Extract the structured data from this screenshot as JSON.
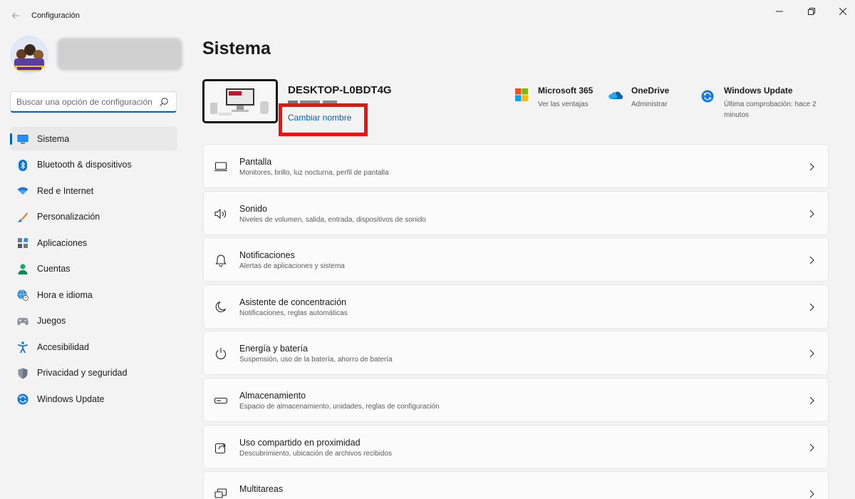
{
  "window": {
    "title": "Configuración"
  },
  "sidebar": {
    "search_placeholder": "Buscar una opción de configuración",
    "items": [
      {
        "label": "Sistema",
        "icon": "monitor-icon",
        "active": true
      },
      {
        "label": "Bluetooth & dispositivos",
        "icon": "bluetooth-icon"
      },
      {
        "label": "Red e Internet",
        "icon": "wifi-icon"
      },
      {
        "label": "Personalización",
        "icon": "brush-icon"
      },
      {
        "label": "Aplicaciones",
        "icon": "apps-icon"
      },
      {
        "label": "Cuentas",
        "icon": "person-icon"
      },
      {
        "label": "Hora e idioma",
        "icon": "globe-clock-icon"
      },
      {
        "label": "Juegos",
        "icon": "gamepad-icon"
      },
      {
        "label": "Accesibilidad",
        "icon": "accessibility-icon"
      },
      {
        "label": "Privacidad y seguridad",
        "icon": "shield-icon"
      },
      {
        "label": "Windows Update",
        "icon": "update-icon"
      }
    ]
  },
  "main": {
    "title": "Sistema",
    "device": {
      "name": "DESKTOP-L0BDT4G",
      "rename_label": "Cambiar nombre"
    },
    "quick_links": [
      {
        "title": "Microsoft 365",
        "subtitle": "Ver las ventajas",
        "icon": "microsoft-logo-icon"
      },
      {
        "title": "OneDrive",
        "subtitle": "Administrar",
        "icon": "onedrive-cloud-icon"
      },
      {
        "title": "Windows Update",
        "subtitle": "Última comprobación: hace 2 minutos",
        "icon": "windows-update-icon"
      }
    ],
    "cards": [
      {
        "title": "Pantalla",
        "subtitle": "Monitores, brillo, luz nocturna, perfil de pantalla",
        "icon": "display-icon"
      },
      {
        "title": "Sonido",
        "subtitle": "Niveles de volumen, salida, entrada, dispositivos de sonido",
        "icon": "speaker-icon"
      },
      {
        "title": "Notificaciones",
        "subtitle": "Alertas de aplicaciones y sistema",
        "icon": "bell-icon"
      },
      {
        "title": "Asistente de concentración",
        "subtitle": "Notificaciones, reglas automáticas",
        "icon": "moon-icon"
      },
      {
        "title": "Energía y batería",
        "subtitle": "Suspensión, uso de la batería, ahorro de batería",
        "icon": "power-icon"
      },
      {
        "title": "Almacenamiento",
        "subtitle": "Espacio de almacenamiento, unidades, reglas de configuración",
        "icon": "storage-icon"
      },
      {
        "title": "Uso compartido en proximidad",
        "subtitle": "Descubrimiento, ubicación de archivos recibidos",
        "icon": "share-icon"
      },
      {
        "title": "Multitareas",
        "subtitle": "",
        "icon": "multitask-icon"
      }
    ]
  },
  "colors": {
    "accent": "#005fb8",
    "highlight_box": "#ee1111",
    "background": "#f3f3f3"
  }
}
